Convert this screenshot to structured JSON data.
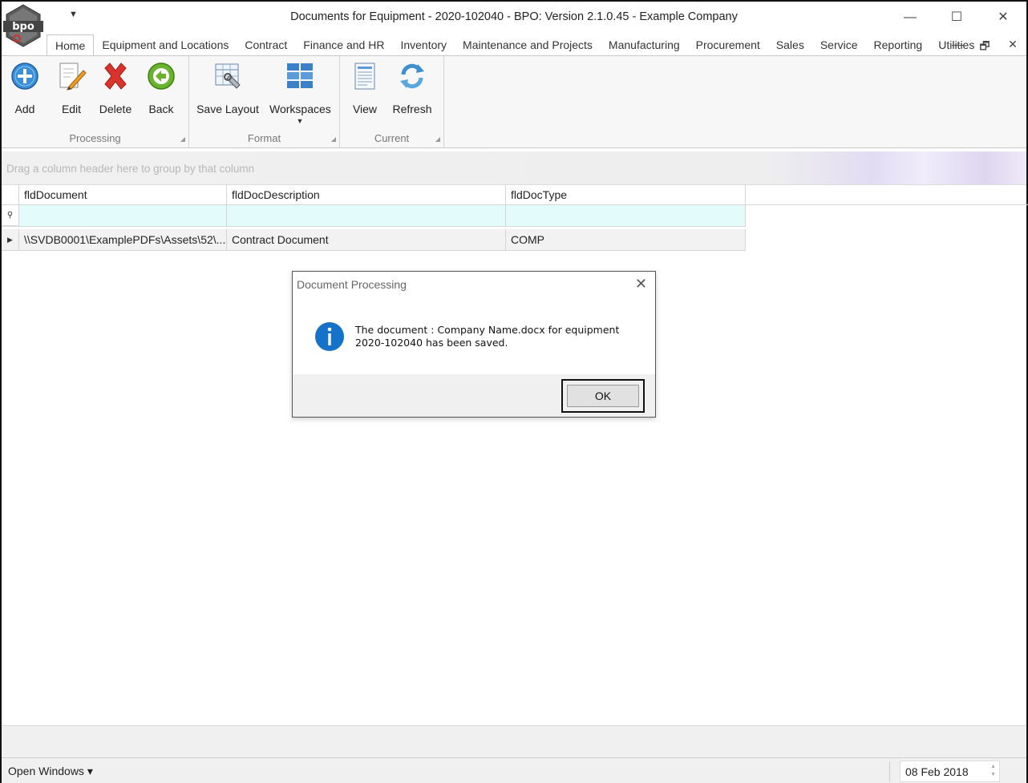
{
  "window": {
    "title": "Documents for Equipment - 2020-102040 - BPO: Version 2.1.0.45 - Example Company",
    "minimize": "—",
    "maximize": "☐",
    "close": "✕"
  },
  "logo_text": "bpo",
  "ribbon": {
    "tabs": [
      "Home",
      "Equipment and Locations",
      "Contract",
      "Finance and HR",
      "Inventory",
      "Maintenance and Projects",
      "Manufacturing",
      "Procurement",
      "Sales",
      "Service",
      "Reporting",
      "Utilities"
    ],
    "active_tab": "Home",
    "groups": {
      "processing": {
        "label": "Processing",
        "buttons": {
          "add": "Add",
          "edit": "Edit",
          "delete": "Delete",
          "back": "Back"
        }
      },
      "format": {
        "label": "Format",
        "buttons": {
          "save_layout": "Save Layout",
          "workspaces": "Workspaces"
        }
      },
      "current": {
        "label": "Current",
        "buttons": {
          "view": "View",
          "refresh": "Refresh"
        }
      }
    }
  },
  "grid": {
    "group_panel_text": "Drag a column header here to group by that column",
    "columns": [
      "fldDocument",
      "fldDocDescription",
      "fldDocType"
    ],
    "rows": [
      [
        "\\\\SVDB0001\\ExamplePDFs\\Assets\\52\\...",
        "Contract Document",
        "COMP"
      ]
    ]
  },
  "dialog": {
    "title": "Document Processing",
    "message": "The document : Company Name.docx for equipment 2020-102040 has been saved.",
    "ok_label": "OK"
  },
  "statusbar": {
    "open_windows": "Open Windows ▾",
    "date": "08 Feb 2018"
  },
  "colors": {
    "filter_row": "#e4fbfb",
    "info_blue": "#1473c8",
    "delete_red": "#d9342b",
    "back_green": "#6ab42d",
    "add_blue": "#3a8fd8"
  }
}
